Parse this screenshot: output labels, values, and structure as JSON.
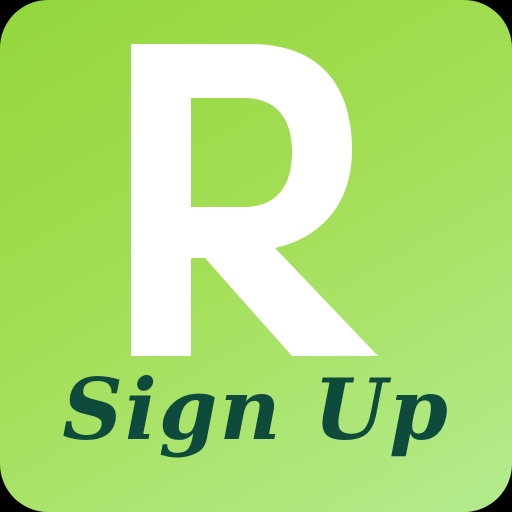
{
  "app": {
    "logo_letter": "R",
    "tagline": "Sign Up"
  },
  "colors": {
    "background_start": "#93d63c",
    "background_end": "#b4ec8f",
    "letter": "#ffffff",
    "tagline": "#0f4b3c",
    "frame": "#000000"
  },
  "icons": {
    "logo": "r-logo-icon"
  }
}
